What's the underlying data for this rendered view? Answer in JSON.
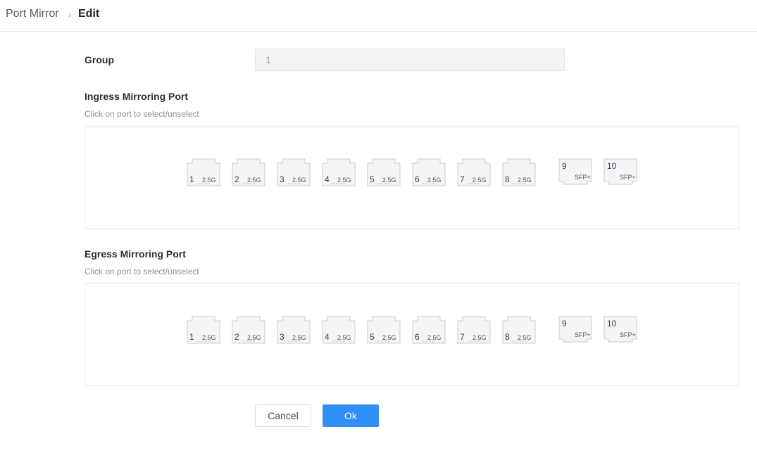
{
  "breadcrumb": {
    "root": "Port Mirror",
    "separator": "›",
    "current": "Edit"
  },
  "form": {
    "group_label": "Group",
    "group_value": "1",
    "ingress": {
      "title": "Ingress Mirroring Port",
      "hint": "Click on port to select/unselect"
    },
    "egress": {
      "title": "Egress Mirroring Port",
      "hint": "Click on port to select/unselect"
    }
  },
  "ports": {
    "rj45": [
      {
        "num": "1",
        "speed": "2.5G"
      },
      {
        "num": "2",
        "speed": "2.5G"
      },
      {
        "num": "3",
        "speed": "2.5G"
      },
      {
        "num": "4",
        "speed": "2.5G"
      },
      {
        "num": "5",
        "speed": "2.5G"
      },
      {
        "num": "6",
        "speed": "2.5G"
      },
      {
        "num": "7",
        "speed": "2.5G"
      },
      {
        "num": "8",
        "speed": "2.5G"
      }
    ],
    "sfp": [
      {
        "num": "9",
        "type": "SFP+"
      },
      {
        "num": "10",
        "type": "SFP+"
      }
    ]
  },
  "buttons": {
    "cancel": "Cancel",
    "ok": "Ok"
  },
  "colors": {
    "primary": "#2f8ff5",
    "port_fill": "#f4f5f7",
    "port_stroke": "#c8ccd2"
  }
}
